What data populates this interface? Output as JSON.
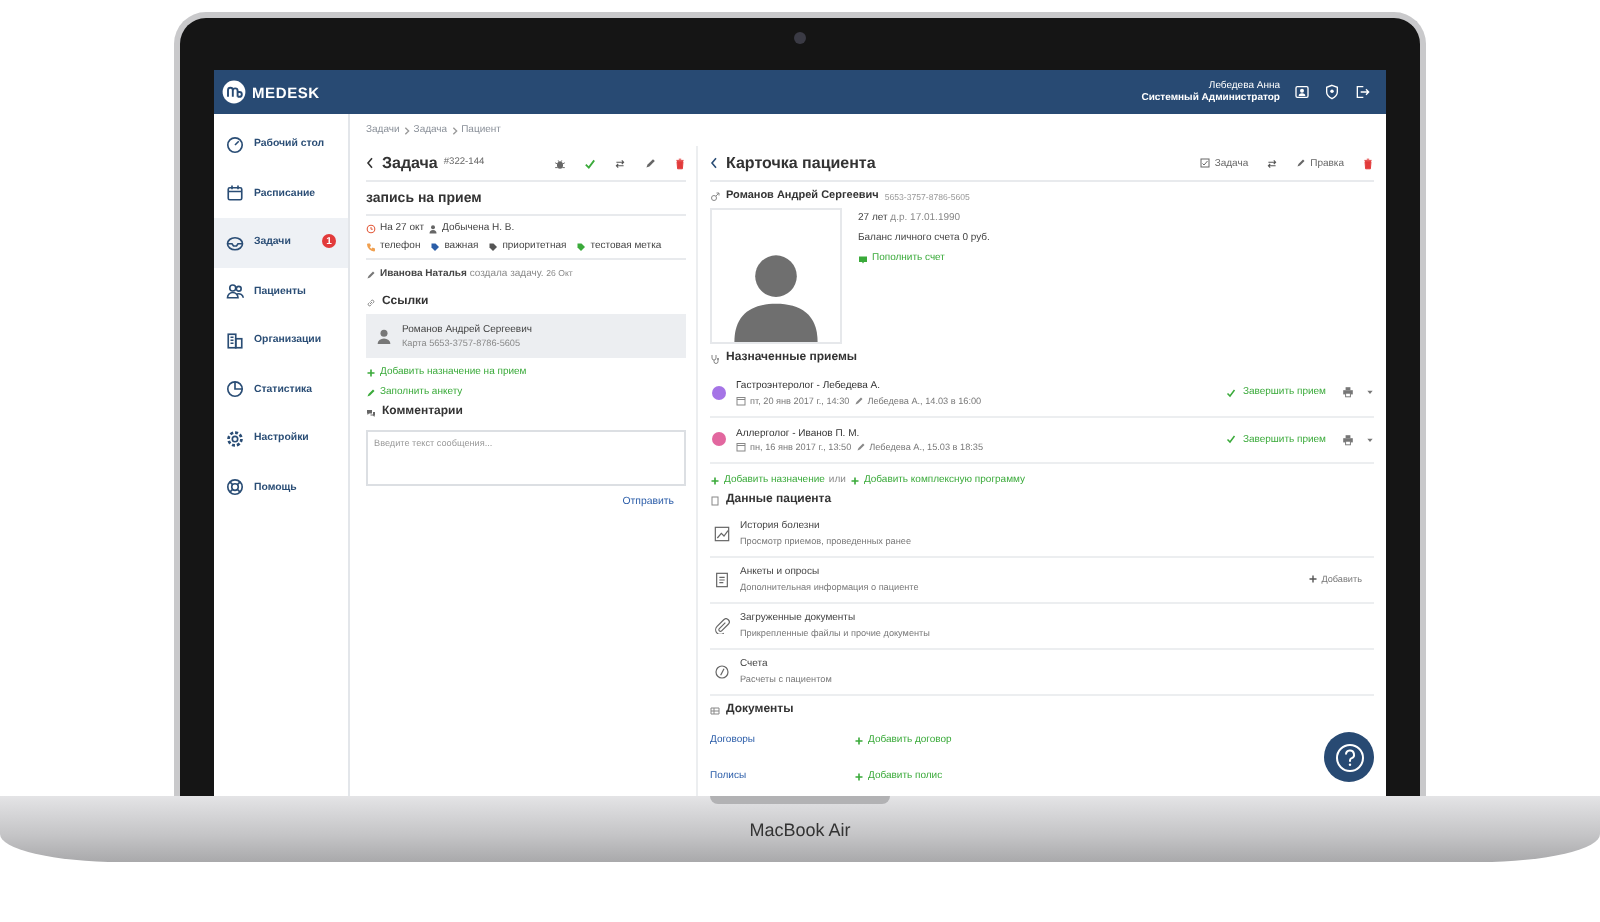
{
  "header": {
    "logo": "MEDESK",
    "user_name": "Лебедева Анна",
    "user_role": "Системный Администратор"
  },
  "sidebar": {
    "items": [
      {
        "label": "Рабочий стол",
        "kind": "desktop",
        "selected": false
      },
      {
        "label": "Расписание",
        "kind": "calendar",
        "selected": false
      },
      {
        "label": "Задачи",
        "kind": "tasks",
        "selected": true,
        "badge": "1"
      },
      {
        "label": "Пациенты",
        "kind": "patients",
        "selected": false
      },
      {
        "label": "Организации",
        "kind": "orgs",
        "selected": false
      },
      {
        "label": "Статистика",
        "kind": "stats",
        "selected": false
      },
      {
        "label": "Настройки",
        "kind": "settings",
        "selected": false
      },
      {
        "label": "Помощь",
        "kind": "help",
        "selected": false
      }
    ]
  },
  "breadcrumb": [
    "Задачи",
    "Задача",
    "Пациент"
  ],
  "task": {
    "title": "Задача",
    "number": "#322-144",
    "subject": "запись на прием",
    "due": "На 27 окт",
    "assignee": "Добычена Н. В.",
    "tags": [
      {
        "label": "телефон",
        "kind": "phone",
        "color": "#f0a050"
      },
      {
        "label": "важная",
        "kind": "tag",
        "color": "#2c5ea8"
      },
      {
        "label": "приоритетная",
        "kind": "tag",
        "color": "#555555"
      },
      {
        "label": "тестовая метка",
        "kind": "tag",
        "color": "#3aaa3a"
      }
    ],
    "log": {
      "author": "Иванова Наталья",
      "action": "создала задачу.",
      "date": "26 Окт"
    },
    "links_title": "Ссылки",
    "link": {
      "name": "Романов Андрей Сергеевич",
      "card": "Карта 5653-3757-8786-5605"
    },
    "actions": [
      "Добавить назначение на прием",
      "Заполнить анкету"
    ],
    "comments_title": "Комментарии",
    "comment_placeholder": "Введите текст сообщения...",
    "send": "Отправить"
  },
  "patient": {
    "title": "Карточка пациента",
    "task_button": "Задача",
    "edit_button": "Правка",
    "name": "Романов Андрей Сергеевич",
    "card": "5653-3757-8786-5605",
    "age": "27 лет",
    "dob": "д.р. 17.01.1990",
    "balance": "Баланс личного счета 0 руб.",
    "top_up": "Пополнить счет",
    "appointments_title": "Назначенные приемы",
    "appointments": [
      {
        "title": "Гастроэнтеролог - Лебедева А.",
        "date": "пт, 20 янв 2017 г., 14:30",
        "edited": "Лебедева А., 14.03 в 16:00",
        "color": "#a574e6",
        "action": "Завершить прием"
      },
      {
        "title": "Аллерголог - Иванов П. М.",
        "date": "пн, 16 янв 2017 г., 13:50",
        "edited": "Лебедева А., 15.03 в 18:35",
        "color": "#e2679f",
        "action": "Завершить прием"
      }
    ],
    "add_appointment": "Добавить назначение",
    "or": "или",
    "add_program": "Добавить комплексную программу",
    "data_title": "Данные пациента",
    "data_items": [
      {
        "kind": "history",
        "title": "История болезни",
        "subtitle": "Просмотр приемов, проведенных ранее"
      },
      {
        "kind": "survey",
        "title": "Анкеты и опросы",
        "subtitle": "Дополнительная информация о пациенте",
        "action": "Добавить"
      },
      {
        "kind": "documents",
        "title": "Загруженные документы",
        "subtitle": "Прикрепленные файлы и прочие документы"
      },
      {
        "kind": "bills",
        "title": "Счета",
        "subtitle": "Расчеты с пациентом"
      }
    ],
    "documents_title": "Документы",
    "documents": [
      {
        "label": "Договоры",
        "action": "Добавить договор"
      },
      {
        "label": "Полисы",
        "action": "Добавить полис"
      }
    ]
  },
  "device_label": "MacBook Air"
}
